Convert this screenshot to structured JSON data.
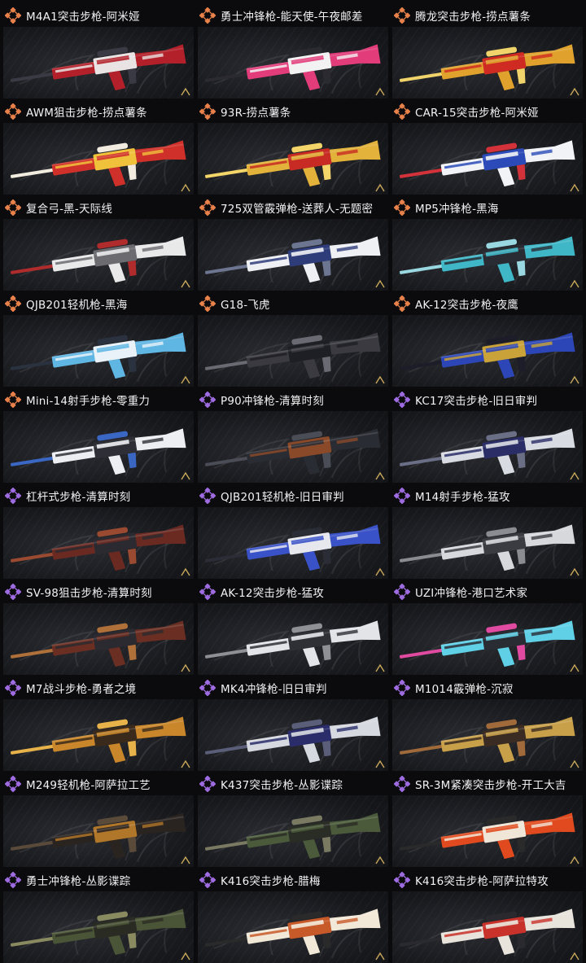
{
  "colors": {
    "legendary": "#e8814a",
    "epic": "#9e6be0",
    "background": "#0b0b0d",
    "text": "#f2f2f2"
  },
  "skins": [
    {
      "title": "M4A1突击步枪-阿米娅",
      "rarity": "legendary",
      "icon": "orange-diamond-rarity-icon",
      "palette": [
        "#b3202a",
        "#e9e3e3",
        "#3a3a44"
      ]
    },
    {
      "title": "勇士冲锋枪-能天使-午夜邮差",
      "rarity": "legendary",
      "icon": "orange-diamond-rarity-icon",
      "palette": [
        "#e23c7a",
        "#f2f2f2",
        "#2a2a30"
      ]
    },
    {
      "title": "腾龙突击步枪-捞点薯条",
      "rarity": "legendary",
      "icon": "orange-diamond-rarity-icon",
      "palette": [
        "#e0a22c",
        "#cf2b22",
        "#f0d36a"
      ]
    },
    {
      "title": "AWM狙击步枪-捞点薯条",
      "rarity": "legendary",
      "icon": "orange-diamond-rarity-icon",
      "palette": [
        "#d0302a",
        "#f0c23c",
        "#f2ece0"
      ]
    },
    {
      "title": "93R-捞点薯条",
      "rarity": "legendary",
      "icon": "orange-diamond-rarity-icon",
      "palette": [
        "#e2b23a",
        "#c82a24",
        "#f3d56a"
      ]
    },
    {
      "title": "CAR-15突击步枪-阿米娅",
      "rarity": "legendary",
      "icon": "orange-diamond-rarity-icon",
      "palette": [
        "#f1f3f6",
        "#2c4bb8",
        "#d4323a"
      ]
    },
    {
      "title": "复合弓-黑-天际线",
      "rarity": "legendary",
      "icon": "orange-diamond-rarity-icon",
      "palette": [
        "#e9e9ea",
        "#6b6b70",
        "#b02c2c"
      ]
    },
    {
      "title": "725双管霰弹枪-送葬人-无题密",
      "rarity": "legendary",
      "icon": "orange-diamond-rarity-icon",
      "palette": [
        "#eef0f4",
        "#2f3c7a",
        "#6c7690"
      ]
    },
    {
      "title": "MP5冲锋枪-黑海",
      "rarity": "legendary",
      "icon": "orange-diamond-rarity-icon",
      "palette": [
        "#3fb7c7",
        "#2a2c33",
        "#9ad8e1"
      ]
    },
    {
      "title": "QJB201轻机枪-黑海",
      "rarity": "legendary",
      "icon": "orange-diamond-rarity-icon",
      "palette": [
        "#5fb6e3",
        "#e8f2f8",
        "#2a3240"
      ]
    },
    {
      "title": "G18-飞虎",
      "rarity": "legendary",
      "icon": "orange-diamond-rarity-icon",
      "palette": [
        "#3a3a40",
        "#1e1f24",
        "#6a6a72"
      ]
    },
    {
      "title": "AK-12突击步枪-夜鹰",
      "rarity": "legendary",
      "icon": "orange-diamond-rarity-icon",
      "palette": [
        "#2c46b8",
        "#c9a23a",
        "#1c1d28"
      ]
    },
    {
      "title": "Mini-14射手步枪-零重力",
      "rarity": "legendary",
      "icon": "orange-diamond-rarity-icon",
      "palette": [
        "#eceef2",
        "#2e2f36",
        "#3a66c4"
      ]
    },
    {
      "title": "P90冲锋枪-清算时刻",
      "rarity": "epic",
      "icon": "purple-diamond-rarity-icon",
      "palette": [
        "#2a2c33",
        "#8a4a2a",
        "#4a4c56"
      ]
    },
    {
      "title": "KC17突击步枪-旧日审判",
      "rarity": "epic",
      "icon": "purple-diamond-rarity-icon",
      "palette": [
        "#d8dbe2",
        "#2a2d66",
        "#6b6f86"
      ]
    },
    {
      "title": "杠杆式步枪-清算时刻",
      "rarity": "epic",
      "icon": "purple-diamond-rarity-icon",
      "palette": [
        "#6a2a22",
        "#2a2a30",
        "#9a4a30"
      ]
    },
    {
      "title": "QJB201轻机枪-旧日审判",
      "rarity": "epic",
      "icon": "purple-diamond-rarity-icon",
      "palette": [
        "#3a52c8",
        "#e6e8ee",
        "#2a2c36"
      ]
    },
    {
      "title": "M14射手步枪-猛攻",
      "rarity": "epic",
      "icon": "purple-diamond-rarity-icon",
      "palette": [
        "#d6d8dc",
        "#3a3c42",
        "#8a8c92"
      ]
    },
    {
      "title": "SV-98狙击步枪-清算时刻",
      "rarity": "epic",
      "icon": "purple-diamond-rarity-icon",
      "palette": [
        "#6a2e22",
        "#2a2a30",
        "#b0703a"
      ]
    },
    {
      "title": "AK-12突击步枪-猛攻",
      "rarity": "epic",
      "icon": "purple-diamond-rarity-icon",
      "palette": [
        "#e2e4e8",
        "#2e3036",
        "#8e9096"
      ]
    },
    {
      "title": "UZI冲锋枪-港口艺术家",
      "rarity": "epic",
      "icon": "purple-diamond-rarity-icon",
      "palette": [
        "#5fd0e6",
        "#2a2c34",
        "#e04aa0"
      ]
    },
    {
      "title": "M7战斗步枪-勇者之境",
      "rarity": "epic",
      "icon": "purple-diamond-rarity-icon",
      "palette": [
        "#c9862a",
        "#3a2a1c",
        "#e8b24a"
      ]
    },
    {
      "title": "MK4冲锋枪-旧日审判",
      "rarity": "epic",
      "icon": "purple-diamond-rarity-icon",
      "palette": [
        "#d6d9e0",
        "#2a2d6a",
        "#5a5e78"
      ]
    },
    {
      "title": "M1014霰弹枪-沉寂",
      "rarity": "epic",
      "icon": "purple-diamond-rarity-icon",
      "palette": [
        "#c9a04a",
        "#3a2c22",
        "#a06a3a"
      ]
    },
    {
      "title": "M249轻机枪-阿萨拉工艺",
      "rarity": "epic",
      "icon": "purple-diamond-rarity-icon",
      "palette": [
        "#2a2420",
        "#b0762a",
        "#5a4a3a"
      ]
    },
    {
      "title": "K437突击步枪-丛影谍踪",
      "rarity": "epic",
      "icon": "purple-diamond-rarity-icon",
      "palette": [
        "#4a5a3a",
        "#2a2c26",
        "#7a7a62"
      ]
    },
    {
      "title": "SR-3M紧凑突击步枪-开工大吉",
      "rarity": "epic",
      "icon": "purple-diamond-rarity-icon",
      "palette": [
        "#e04a1e",
        "#f0e6d8",
        "#2a2a2a"
      ]
    },
    {
      "title": "勇士冲锋枪-丛影谍踪",
      "rarity": "epic",
      "icon": "purple-diamond-rarity-icon",
      "palette": [
        "#4a5436",
        "#2a2c24",
        "#8a8a60"
      ]
    },
    {
      "title": "K416突击步枪-腊梅",
      "rarity": "epic",
      "icon": "purple-diamond-rarity-icon",
      "palette": [
        "#f2e8d8",
        "#c85a2a",
        "#2a2a2a"
      ]
    },
    {
      "title": "K416突击步枪-阿萨拉特攻",
      "rarity": "epic",
      "icon": "purple-diamond-rarity-icon",
      "palette": [
        "#e8e4dc",
        "#c8322a",
        "#2a2a2e"
      ]
    }
  ]
}
